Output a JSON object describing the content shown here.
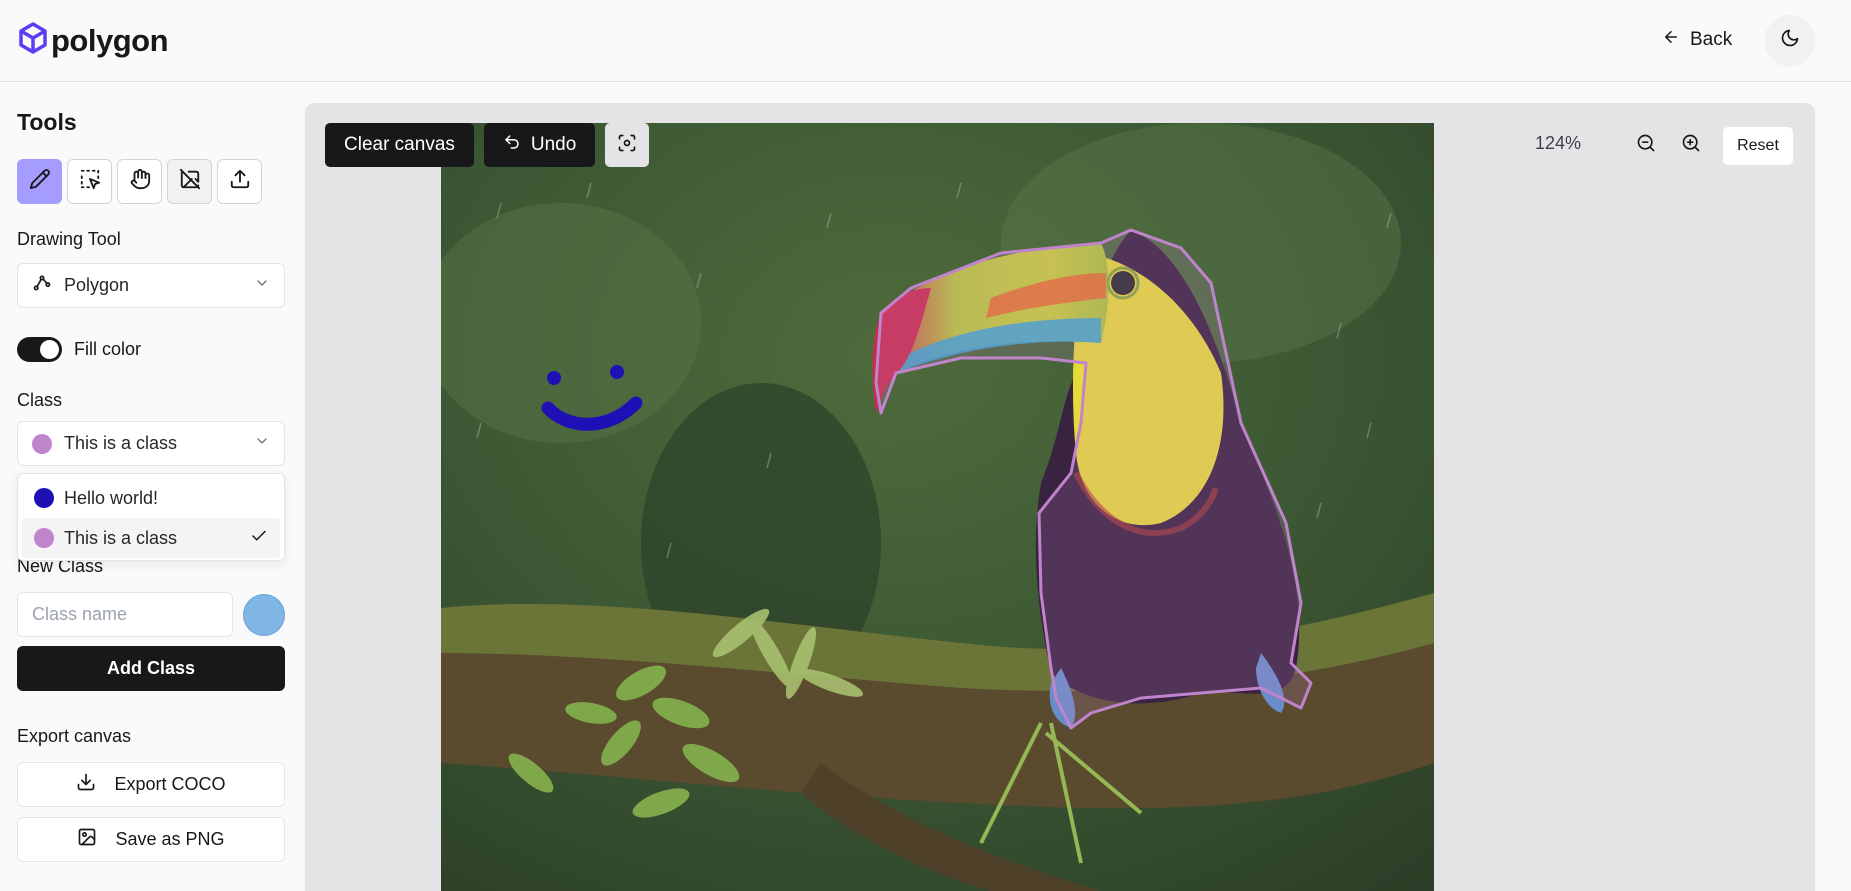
{
  "app": {
    "name": "polygon"
  },
  "header": {
    "back_label": "Back"
  },
  "sidebar": {
    "title": "Tools",
    "tools": [
      "pencil-icon",
      "select-icon",
      "hand-icon",
      "eraser-icon",
      "upload-icon"
    ],
    "drawing_tool": {
      "label": "Drawing Tool",
      "value": "Polygon"
    },
    "fill": {
      "label": "Fill color",
      "enabled": true
    },
    "class": {
      "label": "Class",
      "value": "This is a class",
      "value_color": "#c084cc",
      "options": [
        {
          "label": "Hello world!",
          "color": "#1e10b4",
          "selected": false
        },
        {
          "label": "This is a class",
          "color": "#c084cc",
          "selected": true
        }
      ]
    },
    "new_class": {
      "label": "New Class",
      "placeholder": "Class name",
      "color": "#7fb6e6",
      "add_label": "Add Class"
    },
    "export": {
      "label": "Export canvas",
      "coco_label": "Export COCO",
      "png_label": "Save as PNG"
    }
  },
  "canvas": {
    "clear_label": "Clear canvas",
    "undo_label": "Undo",
    "zoom": "124%",
    "reset_label": "Reset"
  }
}
